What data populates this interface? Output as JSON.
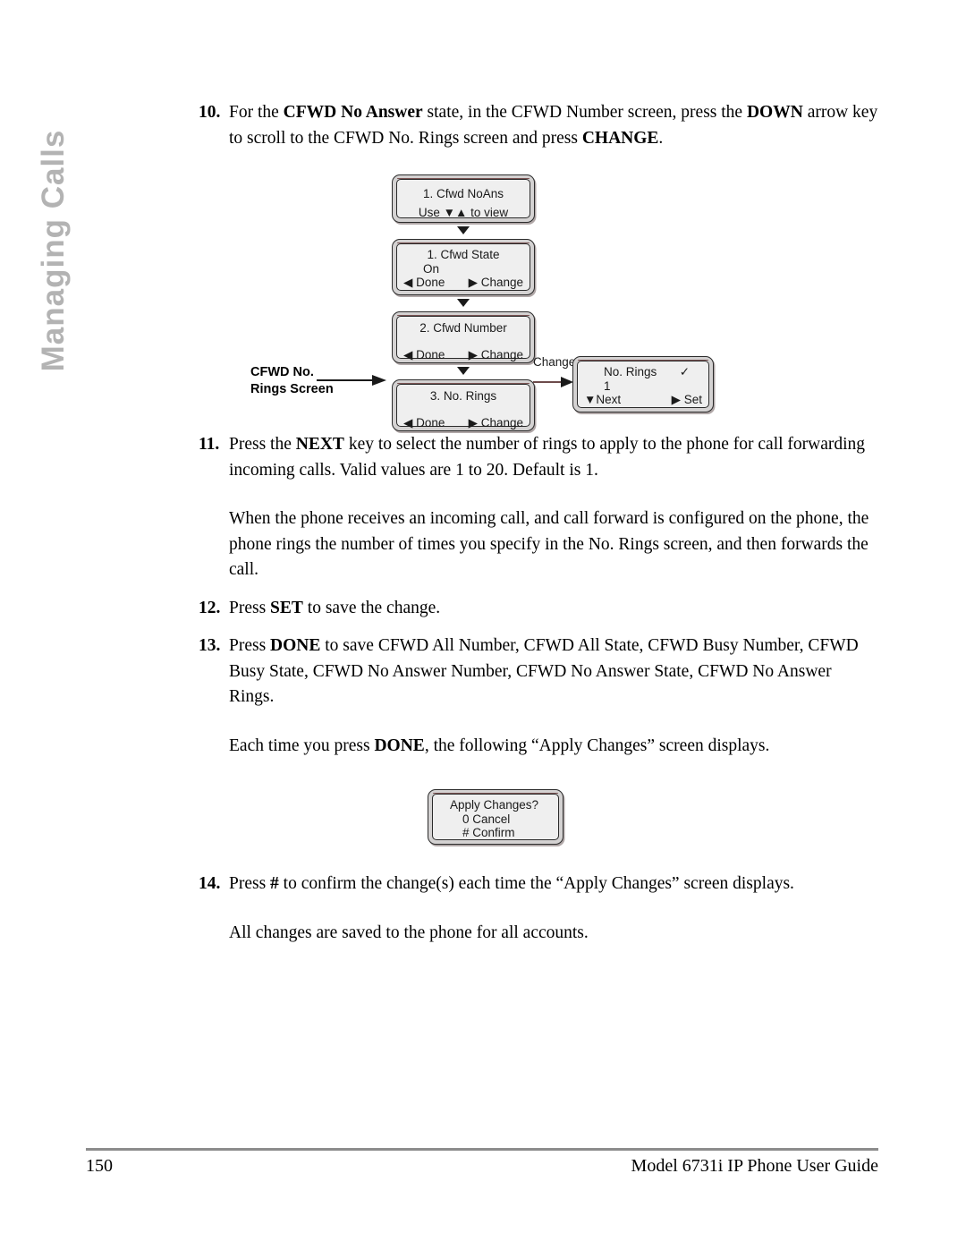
{
  "chapter_tab": {
    "label": "Managing Calls",
    "color": "#b3b3b3"
  },
  "steps": {
    "step10": {
      "number": "10.",
      "part1": "For the ",
      "bold1": "CFWD No Answer",
      "part2": " state, in the CFWD Number screen, press the ",
      "bold2": "DOWN",
      "part3": " arrow key to scroll to the CFWD No. Rings screen and press ",
      "bold3": "CHANGE",
      "part4": "."
    },
    "step11": {
      "number": "11.",
      "part1": "Press the ",
      "bold1": "NEXT",
      "part2": " key to select the number of rings to apply to the phone for call forwarding incoming calls. Valid values are 1 to 20. Default is 1."
    },
    "para11": "When the phone receives an incoming call, and call forward is configured on the phone, the phone rings the number of times you specify in the No. Rings screen, and then forwards the call.",
    "step12": {
      "number": "12.",
      "part1": "Press ",
      "bold1": "SET",
      "part2": " to save the change."
    },
    "step13": {
      "number": "13.",
      "part1": "Press ",
      "bold1": "DONE",
      "part2": " to save CFWD All Number, CFWD All State, CFWD Busy Number, CFWD Busy State, CFWD No Answer Number, CFWD No Answer State, CFWD No Answer Rings."
    },
    "para13": {
      "part1": "Each time you press ",
      "bold1": "DONE",
      "part2": ", the following “Apply Changes” screen displays."
    },
    "step14": {
      "number": "14.",
      "part1": "Press ",
      "bold1": "#",
      "part2": " to confirm the change(s) each time the “Apply Changes” screen displays."
    },
    "para14": "All changes are saved to the phone for all accounts."
  },
  "diagram": {
    "callout": {
      "line1": "CFWD No.",
      "line2": "Rings Screen"
    },
    "change_connector_label": "Change",
    "screens": [
      {
        "id": "cfwd-noans",
        "title": "1. Cfwd NoAns",
        "hint": "Use ▼▲ to view"
      },
      {
        "id": "cfwd-state",
        "title": "1. Cfwd State",
        "value": "On",
        "left_softkey": "◀ Done",
        "right_softkey": "▶ Change"
      },
      {
        "id": "cfwd-number",
        "title": "2. Cfwd Number",
        "left_softkey": "◀ Done",
        "right_softkey": "▶ Change"
      },
      {
        "id": "cfwd-no-rings",
        "title": "3. No. Rings",
        "left_softkey": "◀ Done",
        "right_softkey": "▶ Change"
      }
    ],
    "detail_screen": {
      "id": "no-rings-edit",
      "title": "No. Rings",
      "value": "1",
      "check": "✓",
      "left_softkey": "▼Next",
      "right_softkey": "▶ Set"
    },
    "apply_screen": {
      "id": "apply-changes",
      "title": "Apply Changes?",
      "option1": "0 Cancel",
      "option2": "# Confirm"
    }
  },
  "footer": {
    "page_number": "150",
    "guide_title": "Model 6731i IP Phone User Guide"
  }
}
